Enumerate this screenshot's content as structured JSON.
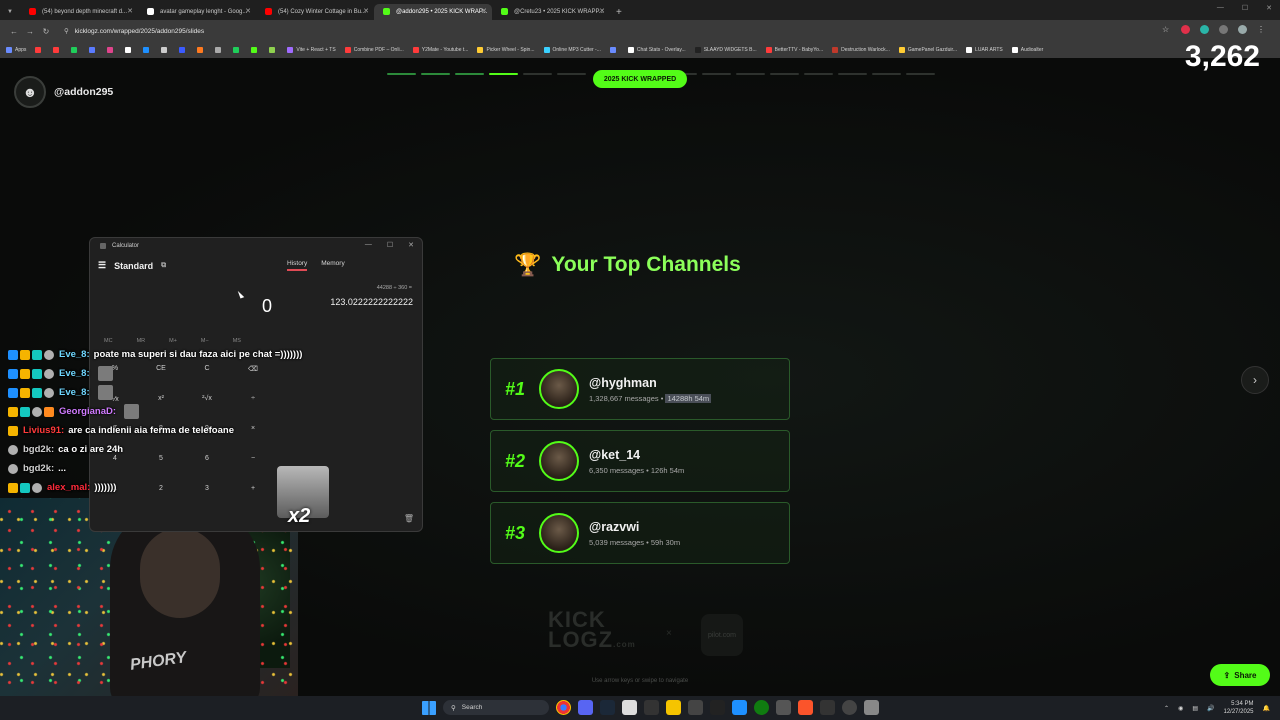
{
  "browser": {
    "tabs": [
      {
        "title": "(54) beyond depth minecraft d...",
        "color": "#ff0000",
        "active": false
      },
      {
        "title": "avatar gameplay lenght - Goog...",
        "color": "#ffffff",
        "active": false
      },
      {
        "title": "(54) Cozy Winter Cottage in Bu...",
        "color": "#ff0000",
        "active": false
      },
      {
        "title": "@addon295 • 2025 KICK WRAP...",
        "color": "#53fc18",
        "active": true
      },
      {
        "title": "@Cretu23 • 2025 KICK WRAPP...",
        "color": "#53fc18",
        "active": false
      }
    ],
    "new_tab": "+",
    "url": "kicklogz.com/wrapped/2025/addon295/slides",
    "bookmarks": [
      {
        "label": "Apps",
        "color": "#6a8cff"
      },
      {
        "label": "",
        "color": "#ff3b3b"
      },
      {
        "label": "",
        "color": "#ff3b3b"
      },
      {
        "label": "",
        "color": "#1fce5a"
      },
      {
        "label": "",
        "color": "#5a7bff"
      },
      {
        "label": "",
        "color": "#e0448c"
      },
      {
        "label": "",
        "color": "#ffffff"
      },
      {
        "label": "",
        "color": "#1e90ff"
      },
      {
        "label": "",
        "color": "#cccccc"
      },
      {
        "label": "",
        "color": "#3b5bff"
      },
      {
        "label": "",
        "color": "#ff7a1f"
      },
      {
        "label": "",
        "color": "#aaaaaa"
      },
      {
        "label": "",
        "color": "#1fce5a"
      },
      {
        "label": "",
        "color": "#53fc18"
      },
      {
        "label": "",
        "color": "#8fd14f"
      },
      {
        "label": "Vite + React + TS",
        "color": "#a06bff"
      },
      {
        "label": "Combine PDF – Onli...",
        "color": "#ff3b3b"
      },
      {
        "label": "Y2Mate - Youtube t...",
        "color": "#ff3b3b"
      },
      {
        "label": "Picker Wheel - Spin...",
        "color": "#ffcc33"
      },
      {
        "label": "Online MP3 Cutter -...",
        "color": "#3bd1ff"
      },
      {
        "label": "",
        "color": "#6a8cff"
      },
      {
        "label": "Chat Stats - Overlay...",
        "color": "#ffffff"
      },
      {
        "label": "SLAAYD WIDGETS B...",
        "color": "#222222"
      },
      {
        "label": "BetterTTV - BabyYo...",
        "color": "#ff3b3b"
      },
      {
        "label": "Destruction Warlock...",
        "color": "#c0392b"
      },
      {
        "label": "GamePanel Gazduir...",
        "color": "#ffcc33"
      },
      {
        "label": "LUAR ARTS",
        "color": "#ffffff"
      },
      {
        "label": "Audioalter",
        "color": "#ffffff"
      }
    ]
  },
  "stream": {
    "viewer_count": "3,262"
  },
  "page": {
    "username": "@addon295",
    "badge": "2025 KICK WRAPPED",
    "progress": {
      "total": 14,
      "completed": 4,
      "current": 4
    },
    "section_title": "Your Top Channels",
    "channels": [
      {
        "rank": "#1",
        "name": "@hyghman",
        "messages": "1,328,667 messages",
        "watch": "14288h 54m",
        "sep": "•"
      },
      {
        "rank": "#2",
        "name": "@ket_14",
        "messages": "6,350 messages",
        "watch": "126h 54m",
        "sep": "•"
      },
      {
        "rank": "#3",
        "name": "@razvwi",
        "messages": "5,039 messages",
        "watch": "59h 30m",
        "sep": "•"
      }
    ],
    "next": "›",
    "footer_logo_line1": "KICK",
    "footer_logo_line2": "LOGZ",
    "footer_logo_suffix": ".com",
    "footer_x": "×",
    "footer_partner": "pilot.com",
    "hint": "Use arrow keys or swipe to navigate",
    "share": "Share"
  },
  "calculator": {
    "title": "Calculator",
    "mode": "Standard",
    "tabs": [
      "History",
      "Memory"
    ],
    "display": "0",
    "history_expr": "44288 ÷ 360 =",
    "history_result": "123.0222222222222",
    "memory_keys": [
      "MC",
      "MR",
      "M+",
      "M−",
      "MS"
    ],
    "keys": [
      "%",
      "CE",
      "C",
      "⌫",
      "⅟x",
      "x²",
      "²√x",
      "÷",
      "7",
      "8",
      "9",
      "×",
      "4",
      "5",
      "6",
      "−",
      "1",
      "2",
      "3",
      "+"
    ]
  },
  "chat": [
    {
      "user": "Eve_8:",
      "user_color": "#6fd7ff",
      "message": "poate ma superi si dau faza aici pe chat =)))))))",
      "emote": false
    },
    {
      "user": "Eve_8:",
      "user_color": "#6fd7ff",
      "message": "",
      "emote": true
    },
    {
      "user": "Eve_8:",
      "user_color": "#6fd7ff",
      "message": "",
      "emote": true
    },
    {
      "user": "GeorgianaD:",
      "user_color": "#d07bff",
      "message": "",
      "emote": true
    },
    {
      "user": "Livius91:",
      "user_color": "#ff3b3b",
      "message": "are ca indienii aia ferma de telefoane",
      "emote": false
    },
    {
      "user": "bgd2k:",
      "user_color": "#d0d0d0",
      "message": "ca o zi are 24h",
      "emote": false
    },
    {
      "user": "bgd2k:",
      "user_color": "#d0d0d0",
      "message": "...",
      "emote": false
    },
    {
      "user": "alex_mal:",
      "user_color": "#ff2b3b",
      "message": ")))))))",
      "emote": false
    }
  ],
  "big_emote_multiplier": "x2",
  "webcam": {
    "shirt_text": "PHORY"
  },
  "taskbar": {
    "search": "Search",
    "time": "5:34 PM",
    "date": "12/27/2025"
  }
}
